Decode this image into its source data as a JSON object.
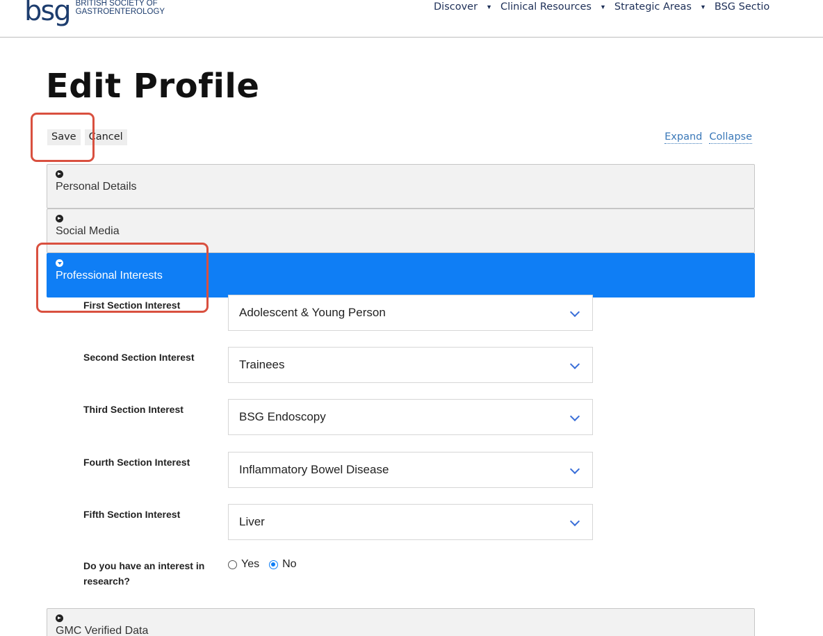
{
  "header": {
    "logo_mark": "bsg",
    "logo_line1": "BRITISH SOCIETY OF",
    "logo_line2": "GASTROENTEROLOGY",
    "nav": [
      {
        "label": "Discover"
      },
      {
        "label": "Clinical Resources"
      },
      {
        "label": "Strategic Areas"
      },
      {
        "label": "BSG Sectio"
      }
    ]
  },
  "page_title": "Edit Profile",
  "toolbar": {
    "save_label": "Save",
    "cancel_label": "Cancel",
    "expand_label": "Expand",
    "collapse_label": "Collapse"
  },
  "sections": {
    "personal": "Personal Details",
    "social": "Social Media",
    "professional": "Professional Interests",
    "gmc": "GMC Verified Data"
  },
  "form": {
    "first": {
      "label": "First Section Interest",
      "value": "Adolescent & Young Person"
    },
    "second": {
      "label": "Second Section Interest",
      "value": "Trainees"
    },
    "third": {
      "label": "Third Section Interest",
      "value": "BSG Endoscopy"
    },
    "fourth": {
      "label": "Fourth Section Interest",
      "value": "Inflammatory Bowel Disease"
    },
    "fifth": {
      "label": "Fifth Section Interest",
      "value": "Liver"
    },
    "research": {
      "label": "Do you have an interest in research?",
      "yes": "Yes",
      "no": "No",
      "selected": "No"
    }
  },
  "colors": {
    "accent": "#0f7ef5",
    "annotation": "#d9503f",
    "link": "#3a78b8"
  }
}
